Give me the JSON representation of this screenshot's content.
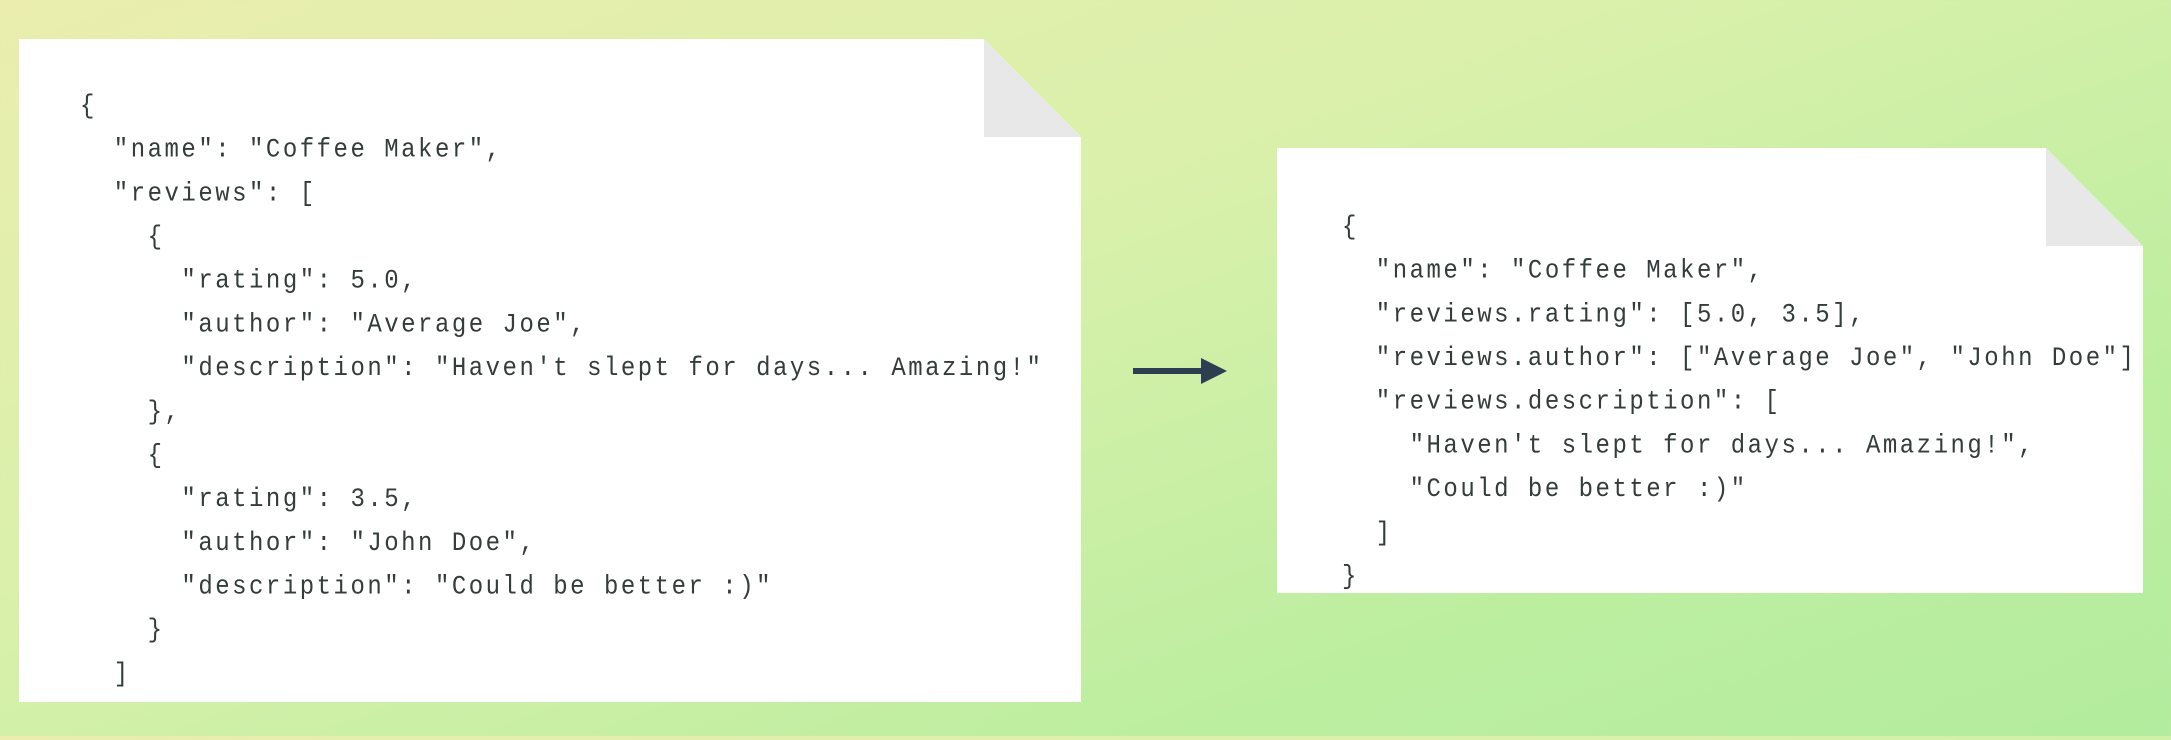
{
  "colors": {
    "arrow": "#2d3e50",
    "text": "#343d3b",
    "fold": "#e8e8e8"
  },
  "input_document": {
    "lines": [
      "{",
      "  \"name\": \"Coffee Maker\",",
      "  \"reviews\": [",
      "    {",
      "      \"rating\": 5.0,",
      "      \"author\": \"Average Joe\",",
      "      \"description\": \"Haven't slept for days... Amazing!\"",
      "    },",
      "    {",
      "      \"rating\": 3.5,",
      "      \"author\": \"John Doe\",",
      "      \"description\": \"Could be better :)\"",
      "    }",
      "  ]",
      "}"
    ]
  },
  "arrow_icon": "arrow-right-icon",
  "output_document": {
    "lines": [
      "{",
      "  \"name\": \"Coffee Maker\",",
      "  \"reviews.rating\": [5.0, 3.5],",
      "  \"reviews.author\": [\"Average Joe\", \"John Doe\"]",
      "  \"reviews.description\": [",
      "    \"Haven't slept for days... Amazing!\",",
      "    \"Could be better :)\"",
      "  ]",
      "}"
    ]
  }
}
